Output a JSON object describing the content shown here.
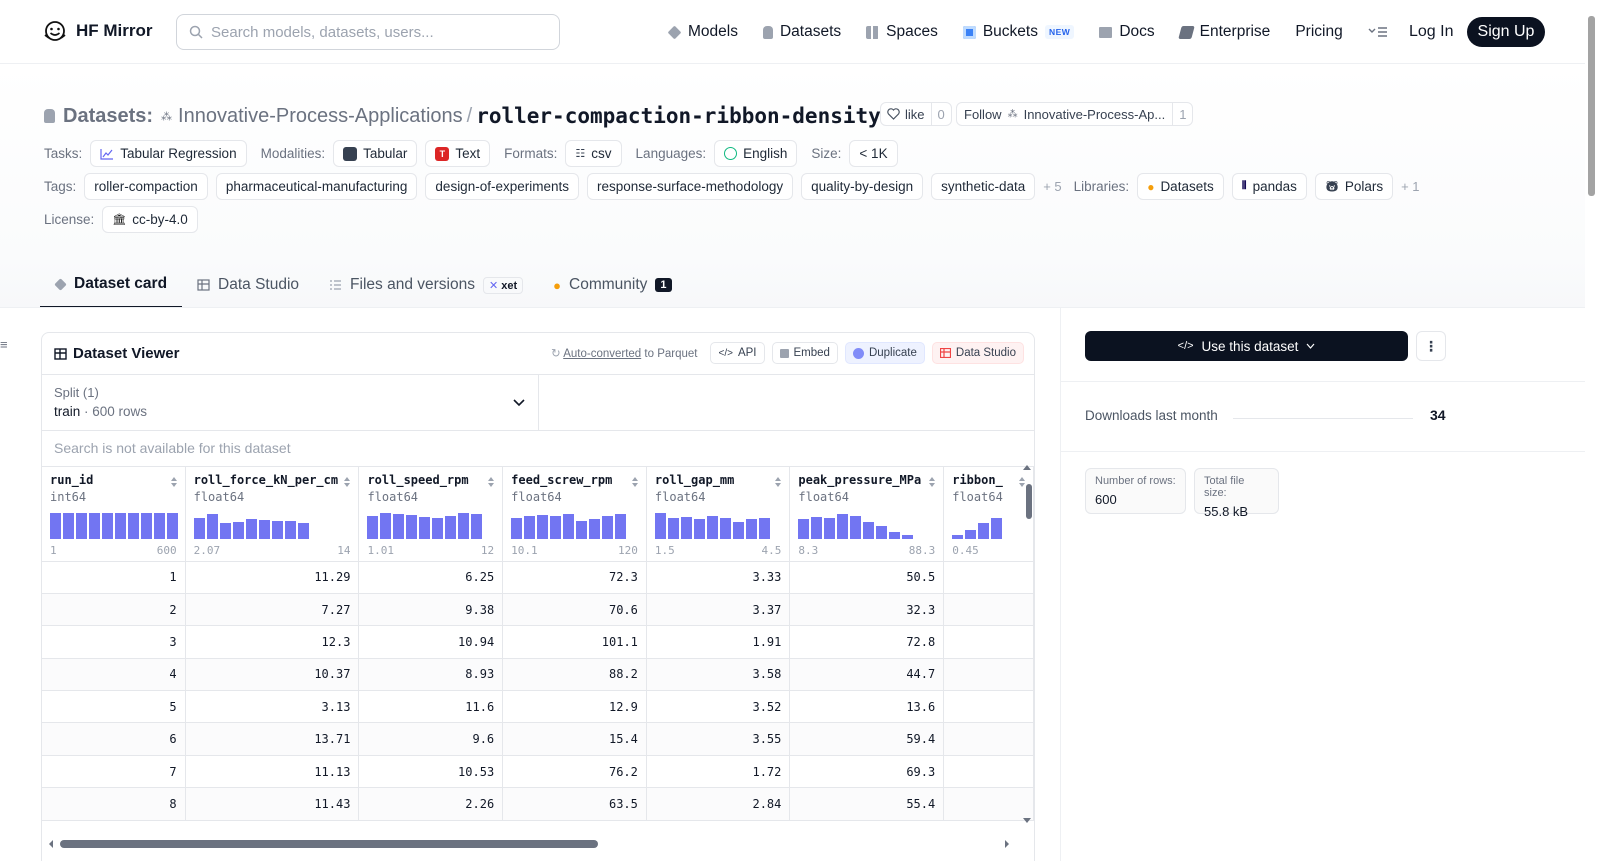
{
  "nav": {
    "brand": "HF Mirror",
    "search_placeholder": "Search models, datasets, users...",
    "items": [
      {
        "label": "Models"
      },
      {
        "label": "Datasets"
      },
      {
        "label": "Spaces"
      },
      {
        "label": "Buckets",
        "badge": "NEW"
      },
      {
        "label": "Docs"
      },
      {
        "label": "Enterprise"
      },
      {
        "label": "Pricing"
      }
    ],
    "login": "Log In",
    "signup": "Sign Up"
  },
  "header": {
    "section": "Datasets:",
    "owner": "Innovative-Process-Applications",
    "sep": "/",
    "name": "roller-compaction-ribbon-density",
    "like_label": "like",
    "like_count": "0",
    "follow_label": "Follow",
    "follow_org": "Innovative-Process-Ap...",
    "follow_count": "1"
  },
  "meta": {
    "tasks_label": "Tasks:",
    "tasks": [
      "Tabular Regression"
    ],
    "modalities_label": "Modalities:",
    "modalities": [
      "Tabular",
      "Text"
    ],
    "formats_label": "Formats:",
    "formats": [
      "csv"
    ],
    "languages_label": "Languages:",
    "languages": [
      "English"
    ],
    "size_label": "Size:",
    "size": "< 1K",
    "tags_label": "Tags:",
    "tags": [
      "roller-compaction",
      "pharmaceutical-manufacturing",
      "design-of-experiments",
      "response-surface-methodology",
      "quality-by-design",
      "synthetic-data"
    ],
    "tags_more": "+ 5",
    "libraries_label": "Libraries:",
    "libraries": [
      "Datasets",
      "pandas",
      "Polars"
    ],
    "libraries_more": "+ 1",
    "license_label": "License:",
    "license": "cc-by-4.0"
  },
  "tabs": [
    {
      "label": "Dataset card",
      "active": true
    },
    {
      "label": "Data Studio"
    },
    {
      "label": "Files and versions",
      "badge": "xet"
    },
    {
      "label": "Community",
      "count": "1"
    }
  ],
  "viewer": {
    "title": "Dataset Viewer",
    "auto_converted": "Auto-converted",
    "to_parquet": "to Parquet",
    "api": "API",
    "embed": "Embed",
    "duplicate": "Duplicate",
    "data_studio": "Data Studio",
    "split_label": "Split (1)",
    "split_name": "train",
    "split_rows": "600 rows",
    "search_na": "Search is not available for this dataset",
    "columns": [
      {
        "name": "run_id",
        "type": "int64",
        "min": "1",
        "max": "600",
        "hist": [
          1,
          1,
          1,
          1,
          1,
          1,
          1,
          1,
          1,
          1
        ]
      },
      {
        "name": "roll_force_kN_per_cm",
        "type": "float64",
        "min": "2.07",
        "max": "14",
        "hist": [
          0.8,
          0.95,
          0.6,
          0.65,
          0.75,
          0.72,
          0.7,
          0.68,
          0.62
        ]
      },
      {
        "name": "roll_speed_rpm",
        "type": "float64",
        "min": "1.01",
        "max": "12",
        "hist": [
          0.9,
          1,
          0.95,
          0.92,
          0.85,
          0.82,
          0.9,
          1,
          0.95
        ]
      },
      {
        "name": "feed_screw_rpm",
        "type": "float64",
        "min": "10.1",
        "max": "120",
        "hist": [
          0.8,
          0.9,
          0.92,
          0.88,
          0.95,
          0.7,
          0.75,
          0.9,
          0.95
        ]
      },
      {
        "name": "roll_gap_mm",
        "type": "float64",
        "min": "1.5",
        "max": "4.5",
        "hist": [
          1,
          0.8,
          0.85,
          0.78,
          0.9,
          0.82,
          0.65,
          0.75,
          0.8
        ]
      },
      {
        "name": "peak_pressure_MPa",
        "type": "float64",
        "min": "8.3",
        "max": "88.3",
        "hist": [
          0.75,
          0.85,
          0.8,
          0.95,
          0.9,
          0.65,
          0.5,
          0.25,
          0.15
        ]
      },
      {
        "name": "ribbon_",
        "type": "float64",
        "min": "0.45",
        "max": "",
        "hist": [
          0.15,
          0.35,
          0.6,
          0.8
        ]
      }
    ],
    "rows": [
      [
        "1",
        "11.29",
        "6.25",
        "72.3",
        "3.33",
        "50.5",
        ""
      ],
      [
        "2",
        "7.27",
        "9.38",
        "70.6",
        "3.37",
        "32.3",
        ""
      ],
      [
        "3",
        "12.3",
        "10.94",
        "101.1",
        "1.91",
        "72.8",
        ""
      ],
      [
        "4",
        "10.37",
        "8.93",
        "88.2",
        "3.58",
        "44.7",
        ""
      ],
      [
        "5",
        "3.13",
        "11.6",
        "12.9",
        "3.52",
        "13.6",
        ""
      ],
      [
        "6",
        "13.71",
        "9.6",
        "15.4",
        "3.55",
        "59.4",
        ""
      ],
      [
        "7",
        "11.13",
        "10.53",
        "76.2",
        "1.72",
        "69.3",
        ""
      ],
      [
        "8",
        "11.43",
        "2.26",
        "63.5",
        "2.84",
        "55.4",
        ""
      ]
    ]
  },
  "sidebar": {
    "use_dataset": "Use this dataset",
    "downloads_label": "Downloads last month",
    "downloads": "34",
    "rows_label": "Number of rows:",
    "rows_value": "600",
    "size_label": "Total file size:",
    "size_value": "55.8 kB"
  },
  "colors": {
    "accent": "#6366f1",
    "dark": "#0b1220"
  }
}
